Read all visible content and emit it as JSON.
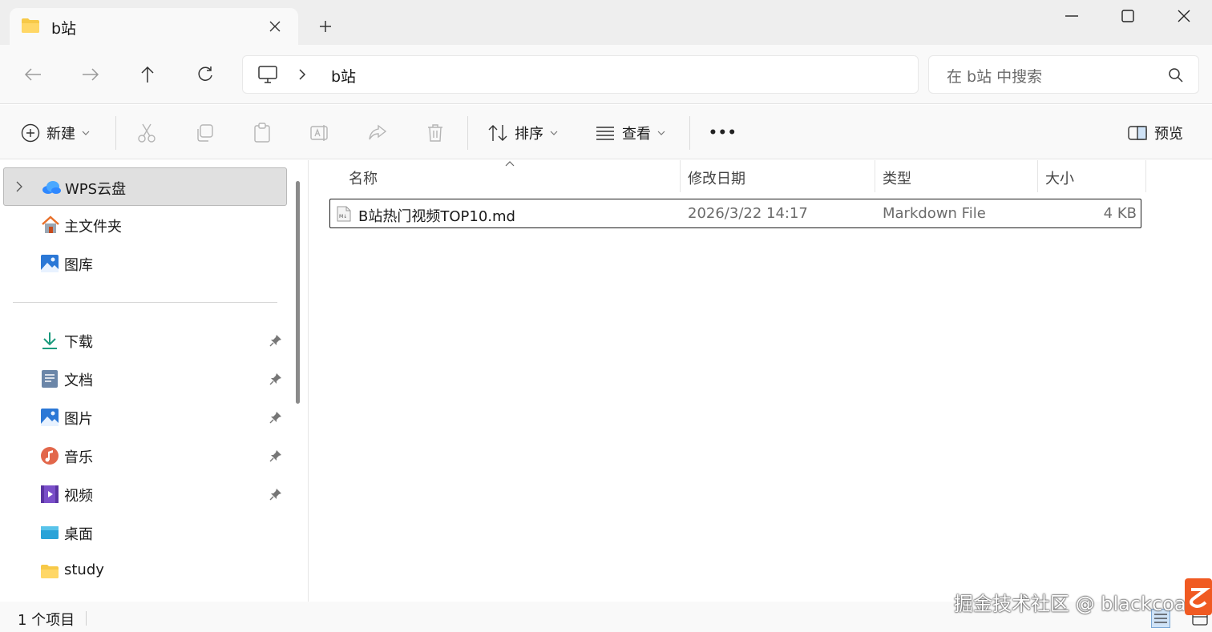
{
  "window": {
    "tab_title": "b站",
    "controls": {
      "minimize": "minimize-icon",
      "maximize": "maximize-icon",
      "close": "close-icon"
    }
  },
  "nav": {
    "breadcrumb": [
      "b站"
    ],
    "search_placeholder": "在 b站 中搜索"
  },
  "toolbar": {
    "new_label": "新建",
    "sort_label": "排序",
    "view_label": "查看",
    "more_label": "•••",
    "preview_label": "预览"
  },
  "sidebar": {
    "top_items": [
      {
        "label": "WPS云盘",
        "icon": "cloud-icon",
        "selected": true
      },
      {
        "label": "主文件夹",
        "icon": "home-icon"
      },
      {
        "label": "图库",
        "icon": "gallery-icon"
      }
    ],
    "quick_items": [
      {
        "label": "下载",
        "icon": "download-icon",
        "pinned": true
      },
      {
        "label": "文档",
        "icon": "document-icon",
        "pinned": true
      },
      {
        "label": "图片",
        "icon": "pictures-icon",
        "pinned": true
      },
      {
        "label": "音乐",
        "icon": "music-icon",
        "pinned": true
      },
      {
        "label": "视频",
        "icon": "video-icon",
        "pinned": true
      },
      {
        "label": "桌面",
        "icon": "desktop-icon"
      },
      {
        "label": "study",
        "icon": "folder-icon"
      }
    ]
  },
  "file_list": {
    "columns": [
      "名称",
      "修改日期",
      "类型",
      "大小"
    ],
    "rows": [
      {
        "name": "B站热门视频TOP10.md",
        "modified": "2026/3/22 14:17",
        "type": "Markdown File",
        "size": "4 KB"
      }
    ]
  },
  "status": {
    "item_count": "1 个项目",
    "watermark": "掘金技术社区 @ blackcoal"
  },
  "colors": {
    "titlebar_bg": "#eeeeee",
    "toolbar_bg": "#f9f9f9",
    "selected_bg": "#e0e0e0",
    "folder_yellow": "#f7c948",
    "accent_blue": "#0067c0"
  }
}
